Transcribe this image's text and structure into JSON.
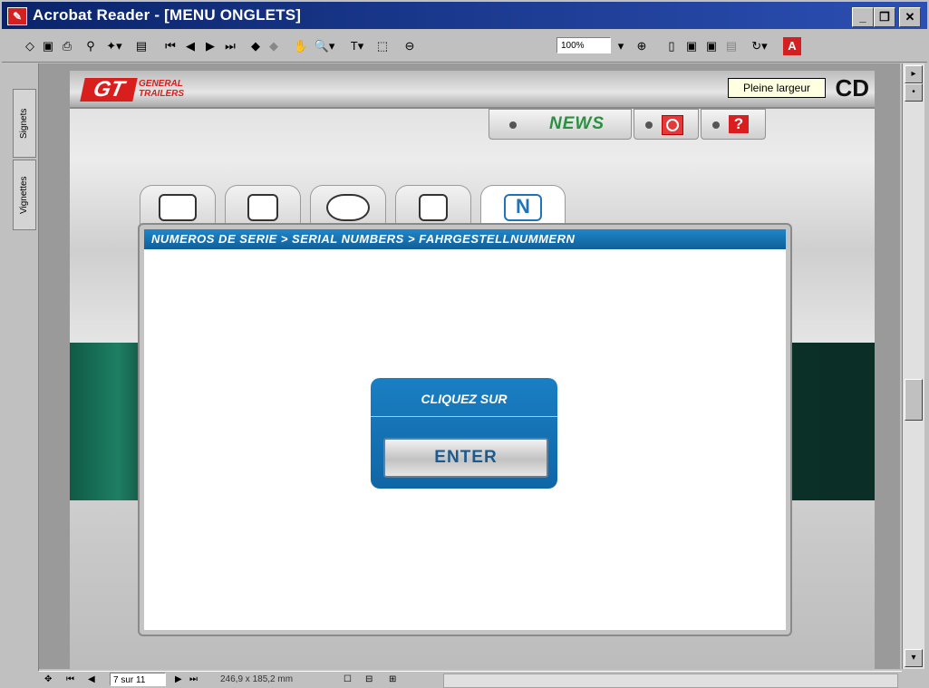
{
  "window": {
    "title": "Acrobat Reader - [MENU ONGLETS]",
    "app_icon": "acrobat-icon",
    "controls": [
      "_",
      "❐",
      "✕"
    ]
  },
  "toolbar": {
    "zoom_value": "100%",
    "tools": [
      "open-icon",
      "save-icon",
      "print-icon",
      "find-icon",
      "search-icon",
      "thumbnails-icon",
      "first-page-icon",
      "prev-page-icon",
      "next-page-icon",
      "last-page-icon",
      "back-icon",
      "forward-icon",
      "hand-tool-icon",
      "zoom-tool-icon",
      "text-select-icon",
      "graphics-select-icon",
      "zoom-out-icon",
      "zoom-in-icon",
      "actual-size-icon",
      "fit-page-icon",
      "fit-width-icon",
      "reflow-icon",
      "rotate-icon",
      "adobe-icon"
    ]
  },
  "tooltip": "Pleine largeur",
  "left_panel": {
    "tabs": [
      "Signets",
      "Vignettes"
    ]
  },
  "document": {
    "logo_main": "GT",
    "logo_sub_1": "GENERAL",
    "logo_sub_2": "TRAILERS",
    "corner_text": "CD",
    "news_label": "NEWS",
    "panel_title": "NUMEROS DE SERIE > SERIAL NUMBERS > FAHRGESTELLNUMMERN",
    "tabs": [
      "box-tab-icon",
      "info-tab-icon",
      "eye-tab-icon",
      "document-tab-icon",
      "n-tab-icon"
    ],
    "active_tab_letter": "N",
    "enter_caption": "CLIQUEZ SUR",
    "enter_button": "ENTER"
  },
  "statusbar": {
    "page_indicator": "7 sur 11",
    "page_size": "246,9 x 185,2 mm"
  },
  "colors": {
    "titlebar": "#0a246a",
    "brand_red": "#d91e1e",
    "accent_blue": "#1a7fc3",
    "news_green": "#2a8f3f",
    "dark_green": "#0e3f33"
  }
}
